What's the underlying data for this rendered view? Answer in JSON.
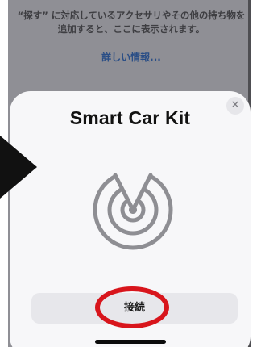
{
  "background": {
    "description_text": "“探す” に対応しているアクセサリやその他の持ち物を追加すると、ここに表示されます。",
    "more_info_link": "詳しい情報..."
  },
  "sheet": {
    "title": "Smart Car Kit",
    "close_icon": "close-icon",
    "device_icon": "radar-icon",
    "connect_label": "接続"
  },
  "colors": {
    "annotation_ring": "#d8151c",
    "link": "#2a4e86",
    "sheet_bg": "#f7f7f9",
    "dimmed_bg": "#8f8f95"
  }
}
